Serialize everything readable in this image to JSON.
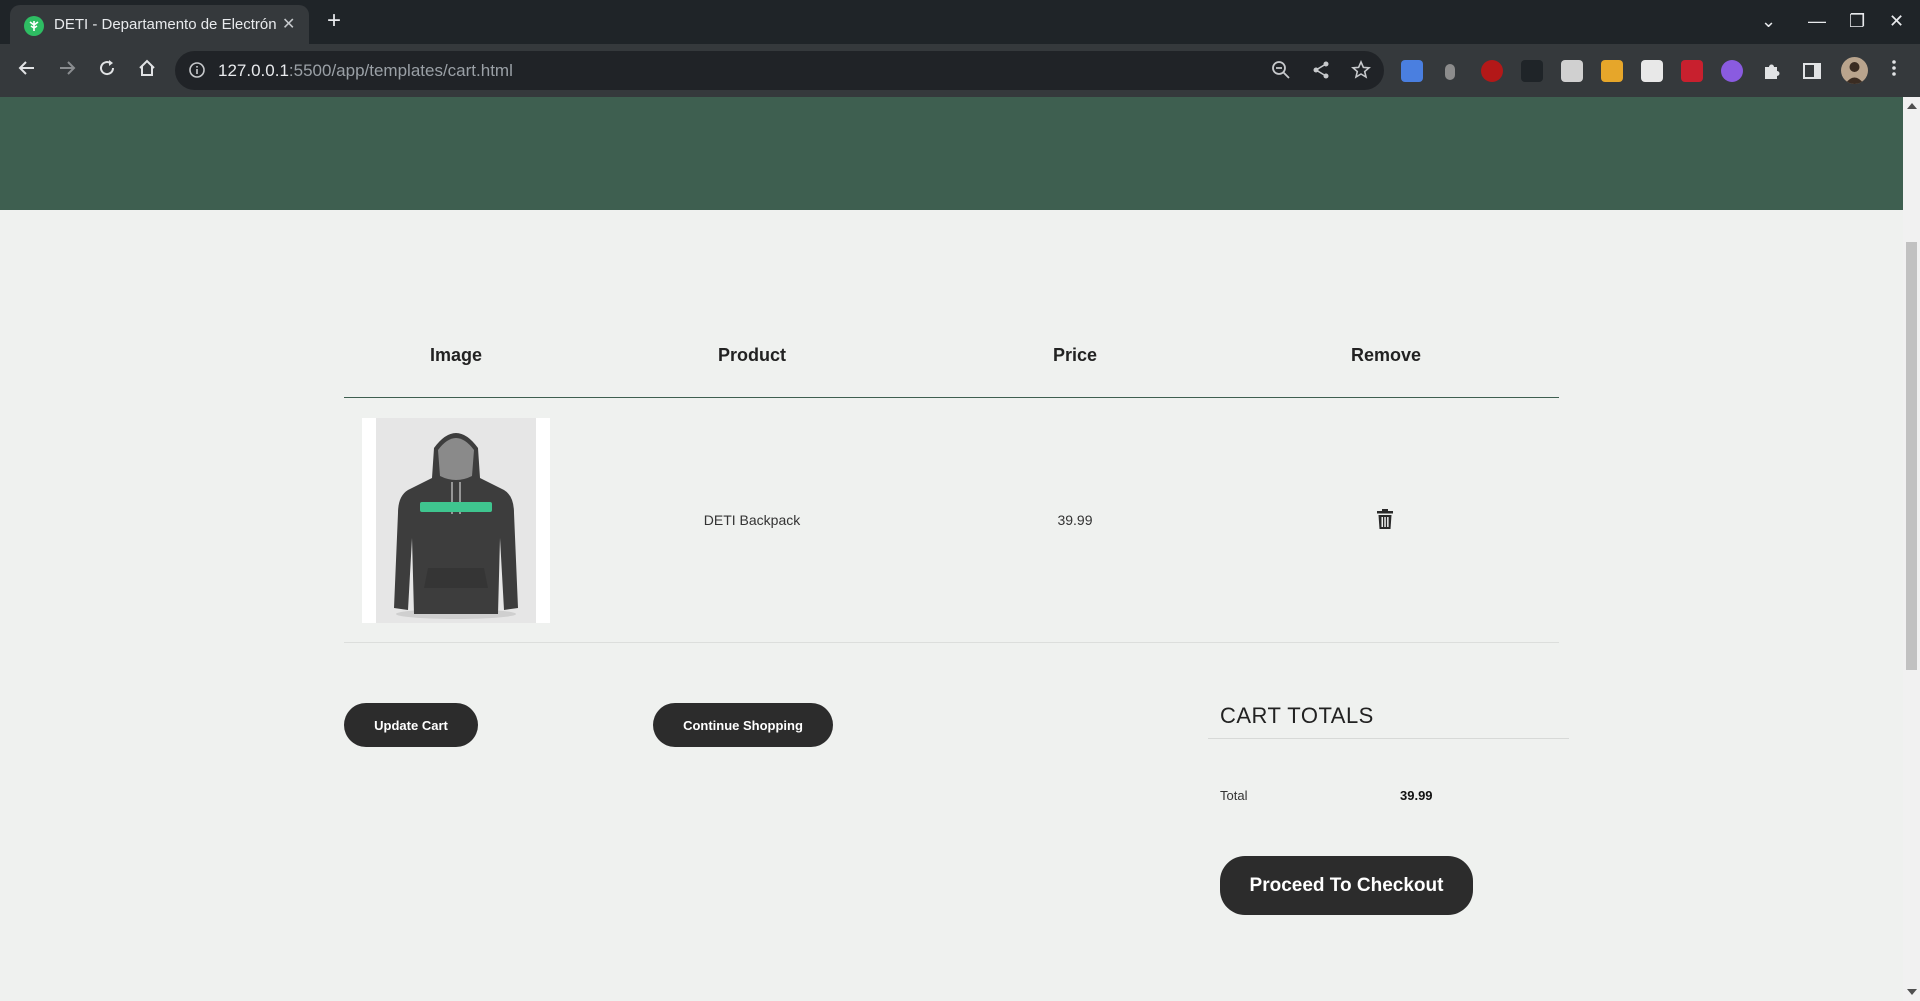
{
  "browser": {
    "tab_title": "DETI - Departamento de Electrónica",
    "tab_close": "✕",
    "new_tab": "+",
    "url_host": "127.0.0.1",
    "url_path": ":5500/app/templates/cart.html",
    "window_controls": {
      "tab_search": "⌄",
      "minimize": "—",
      "restore": "❐",
      "close": "✕"
    }
  },
  "cart": {
    "headers": {
      "image": "Image",
      "product": "Product",
      "price": "Price",
      "remove": "Remove"
    },
    "items": [
      {
        "product": "DETI Backpack",
        "price": "39.99"
      }
    ],
    "buttons": {
      "update": "Update Cart",
      "continue": "Continue Shopping"
    }
  },
  "totals": {
    "title": "CART TOTALS",
    "total_label": "Total",
    "total_value": "39.99",
    "checkout": "Proceed To Checkout"
  },
  "colors": {
    "header_green": "#3e5f50",
    "page_bg": "#eff1ef",
    "button_dark": "#2c2c2c"
  }
}
